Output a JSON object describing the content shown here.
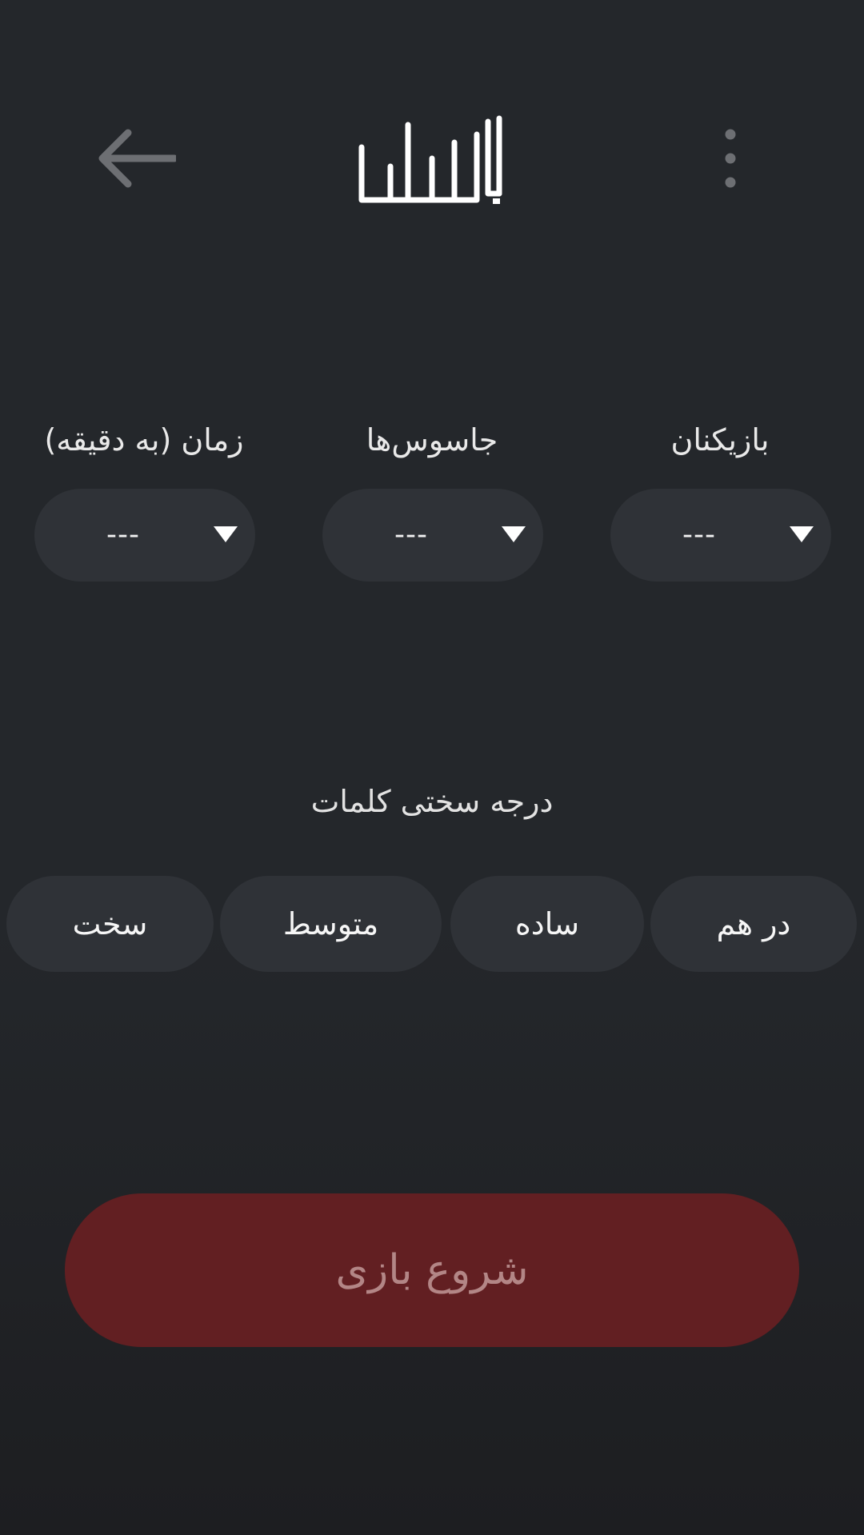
{
  "header": {
    "back_icon": "arrow-left-icon",
    "logo_text": "جاسوس",
    "menu_icon": "more-vertical-icon"
  },
  "selectors": [
    {
      "label": "بازیکنان",
      "value": "---"
    },
    {
      "label": "جاسوس‌ها",
      "value": "---"
    },
    {
      "label": "زمان (به دقیقه)",
      "value": "---"
    }
  ],
  "difficulty": {
    "title": "درجه سختی کلمات",
    "options": [
      "در هم",
      "ساده",
      "متوسط",
      "سخت"
    ]
  },
  "start_button": {
    "label": "شروع بازی"
  },
  "colors": {
    "background": "#24272b",
    "control": "#2f3237",
    "start_button": "#621f22",
    "start_text": "#b38686"
  }
}
